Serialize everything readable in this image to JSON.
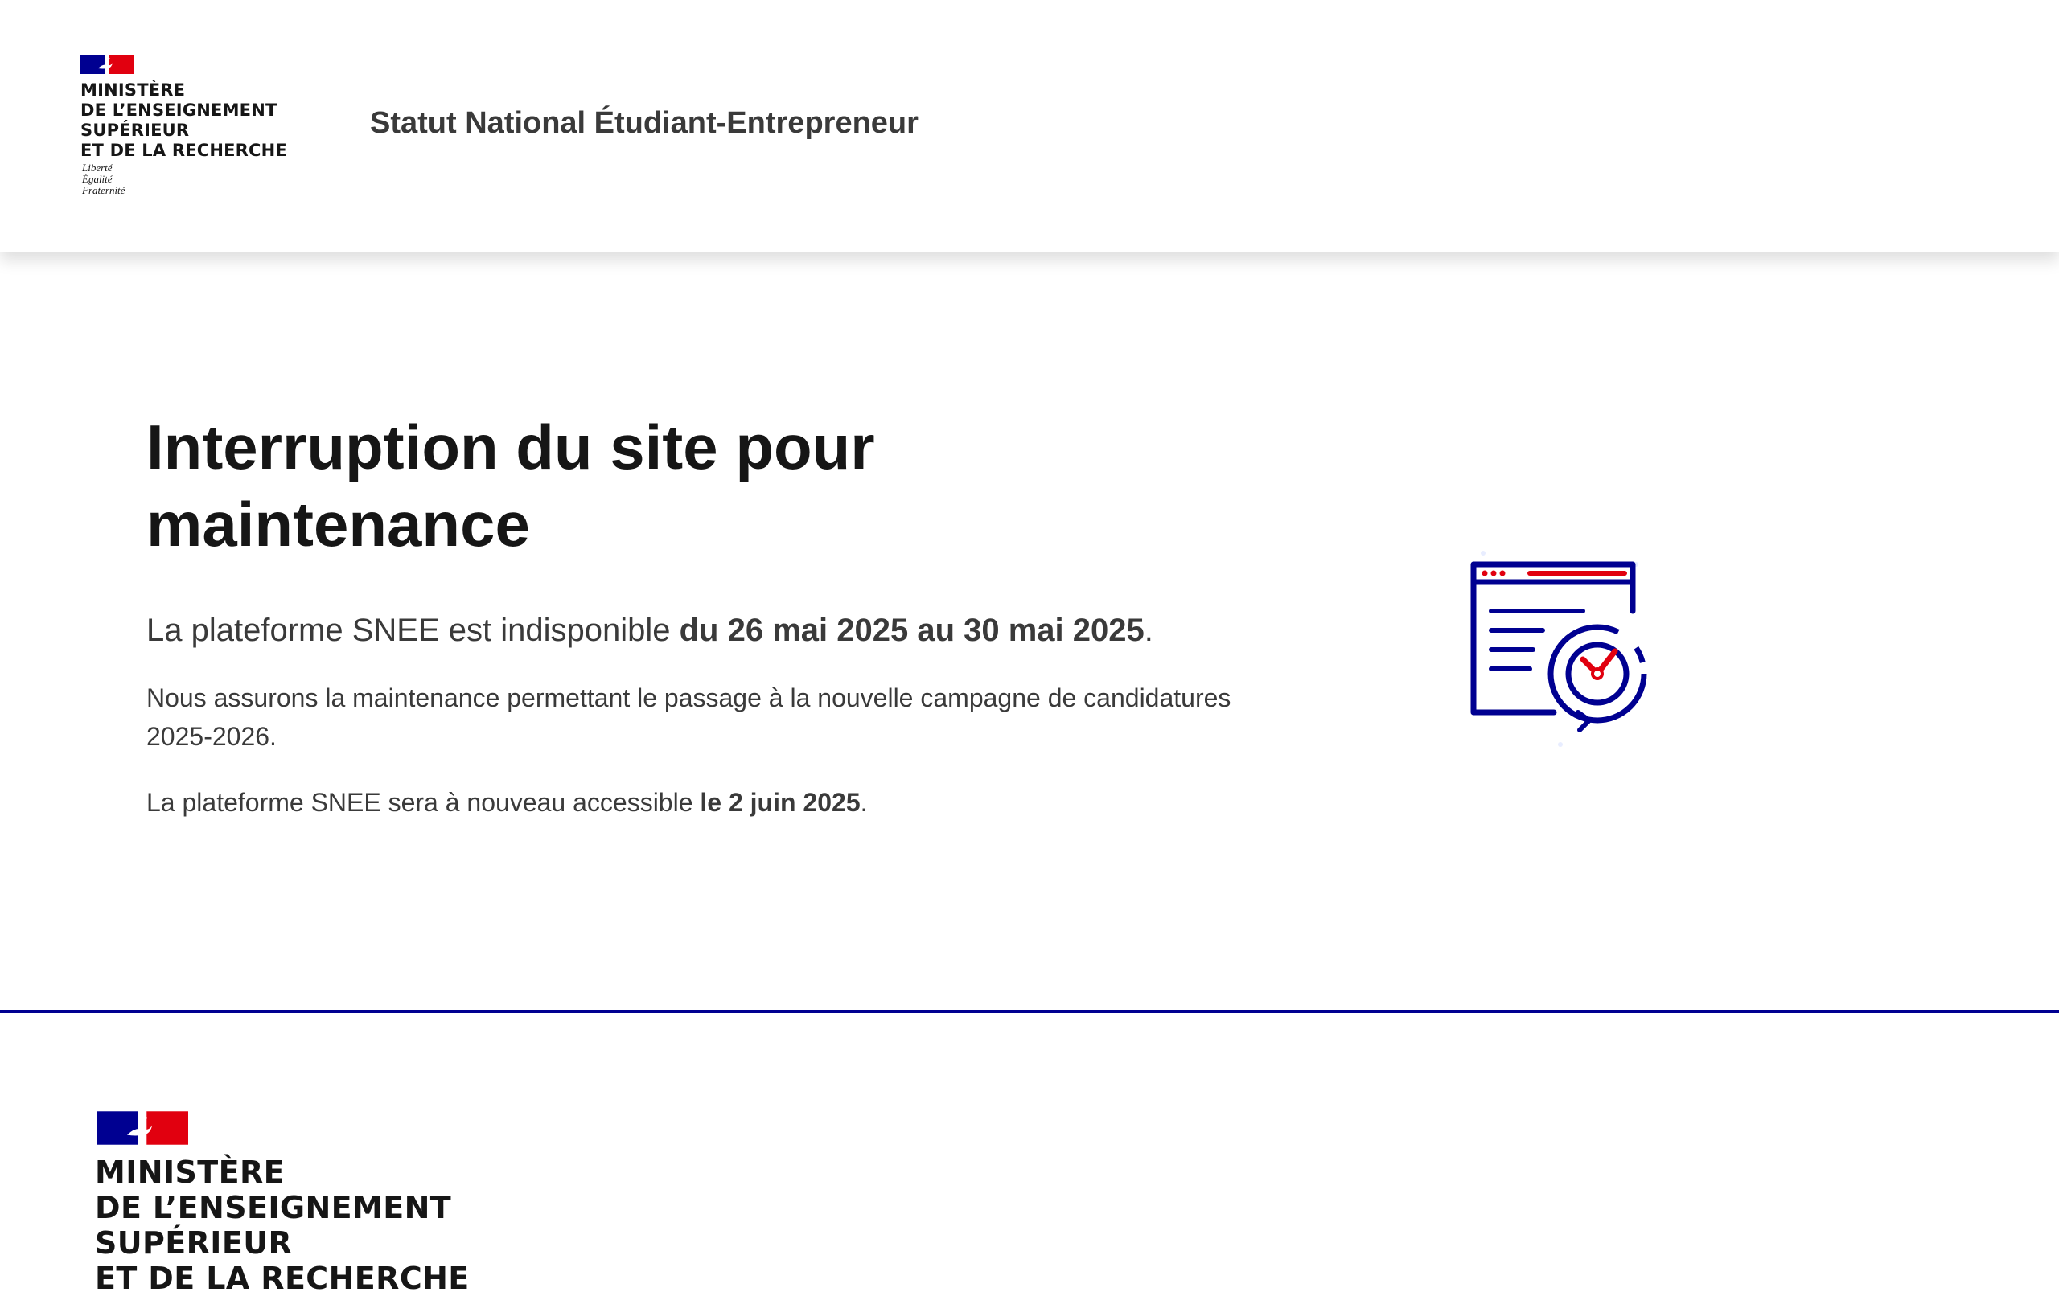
{
  "header": {
    "ministry_lines": [
      "MINISTÈRE",
      "DE L’ENSEIGNEMENT",
      "SUPÉRIEUR",
      "ET DE LA RECHERCHE"
    ],
    "devise_lines": [
      "Liberté",
      "Égalité",
      "Fraternité"
    ],
    "site_title": "Statut National Étudiant-Entrepreneur"
  },
  "main": {
    "headline": "Interruption du site pour maintenance",
    "lead_prefix": "La plateforme SNEE est indisponible ",
    "lead_bold": "du 26 mai 2025 au 30 mai 2025",
    "lead_suffix": ".",
    "para1": "Nous assurons la maintenance permettant le passage à la nouvelle campagne de candidatures 2025-2026.",
    "para2_prefix": "La plateforme SNEE sera à nouveau accessible ",
    "para2_bold": "le 2 juin 2025",
    "para2_suffix": ".",
    "illustration_icon": "maintenance-browser-clock-icon"
  },
  "footer": {
    "ministry_lines": [
      "MINISTÈRE",
      "DE L’ENSEIGNEMENT",
      "SUPÉRIEUR",
      "ET DE LA RECHERCHE"
    ]
  },
  "colors": {
    "blue_france": "#000091",
    "red_marianne": "#e1000f",
    "text": "#161616",
    "text_secondary": "#3a3a3a"
  }
}
